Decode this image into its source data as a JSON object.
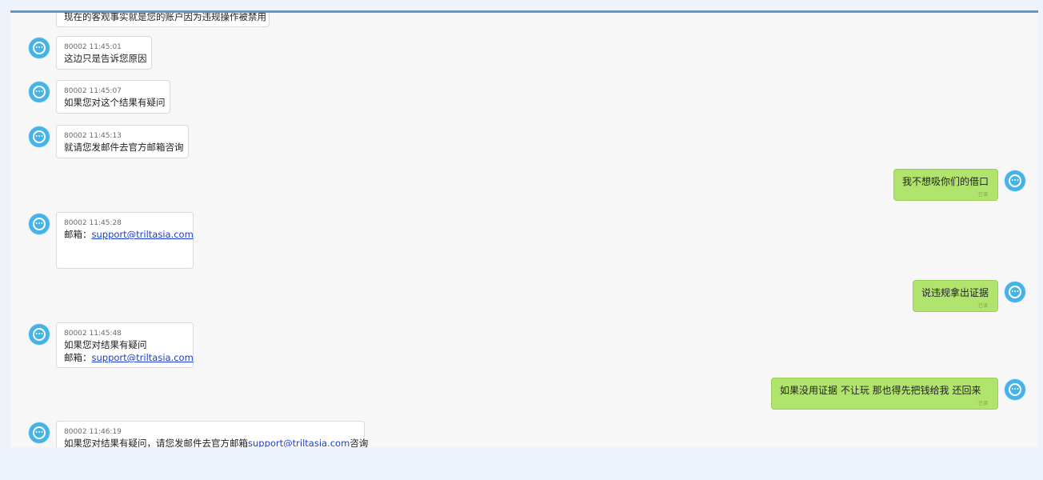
{
  "messages": [
    {
      "side": "left",
      "meta": "",
      "text": "现在的客观事实就是您的账户因为违规操作被禁用"
    },
    {
      "side": "left",
      "meta": "80002 11:45:01",
      "text": "这边只是告诉您原因"
    },
    {
      "side": "left",
      "meta": "80002 11:45:07",
      "text": "如果您对这个结果有疑问"
    },
    {
      "side": "left",
      "meta": "80002 11:45:13",
      "text": "就请您发邮件去官方邮箱咨询"
    },
    {
      "side": "right",
      "text": "我不想吸你们的借口",
      "status": "已读"
    },
    {
      "side": "left",
      "meta": "80002 11:45:28",
      "text_prefix": "邮箱：",
      "link": "support@triltasia.com"
    },
    {
      "side": "right",
      "text": "说违规拿出证据",
      "status": "已读"
    },
    {
      "side": "left",
      "meta": "80002 11:45:48",
      "text": "如果您对结果有疑问",
      "text_prefix": "邮箱：",
      "link": "support@triltasia.com"
    },
    {
      "side": "right",
      "text": "如果没用证据  不让玩  那也得先把钱给我  还回来",
      "status": "已读"
    },
    {
      "side": "left",
      "meta": "80002 11:46:19",
      "text_prefix": "如果您对结果有疑问，请您发邮件去官方邮箱",
      "link": "support@triltasia.com",
      "text_suffix": "咨询"
    }
  ],
  "colors": {
    "agent_avatar": "#45b3e8",
    "user_bubble": "#b1e46c",
    "accent": "#5b9bd5"
  },
  "icons": {
    "avatar": "agent-headset-icon"
  }
}
